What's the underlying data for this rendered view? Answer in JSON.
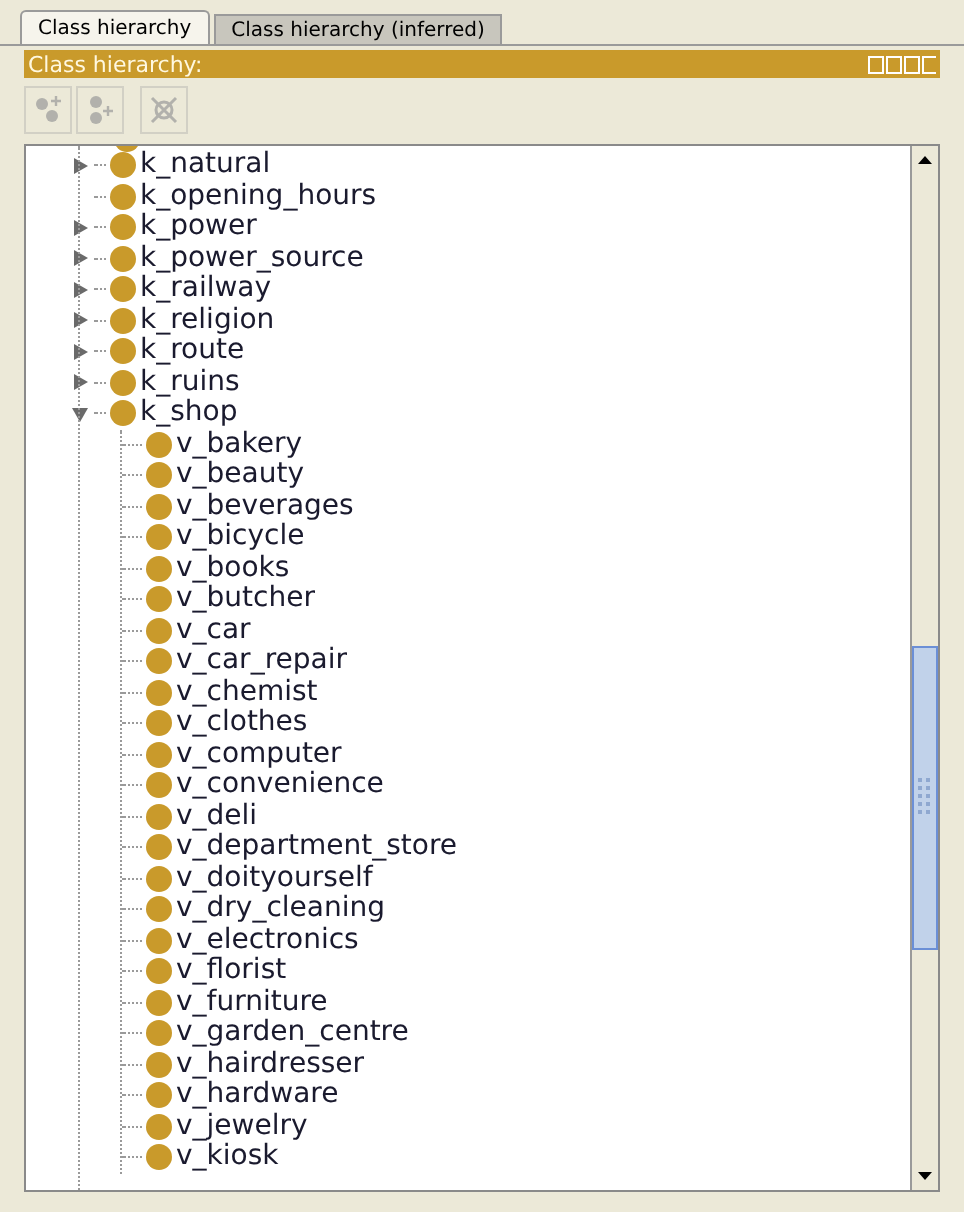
{
  "tabs": [
    {
      "label": "Class hierarchy",
      "selected": true
    },
    {
      "label": "Class hierarchy (inferred)",
      "selected": false
    }
  ],
  "panel": {
    "title": "Class hierarchy:"
  },
  "toolbar": [
    {
      "kind": "add-subclass",
      "disabled": true
    },
    {
      "kind": "add-sibling",
      "disabled": true
    },
    {
      "kind": "delete",
      "disabled": true
    }
  ],
  "tree": [
    {
      "label": "k_natural",
      "kind": "branch",
      "expanded": false
    },
    {
      "label": "k_opening_hours",
      "kind": "leaf"
    },
    {
      "label": "k_power",
      "kind": "branch",
      "expanded": false
    },
    {
      "label": "k_power_source",
      "kind": "branch",
      "expanded": false
    },
    {
      "label": "k_railway",
      "kind": "branch",
      "expanded": false
    },
    {
      "label": "k_religion",
      "kind": "branch",
      "expanded": false
    },
    {
      "label": "k_route",
      "kind": "branch",
      "expanded": false
    },
    {
      "label": "k_ruins",
      "kind": "branch",
      "expanded": false
    },
    {
      "label": "k_shop",
      "kind": "branch",
      "expanded": true,
      "children": [
        {
          "label": "v_bakery"
        },
        {
          "label": "v_beauty"
        },
        {
          "label": "v_beverages"
        },
        {
          "label": "v_bicycle"
        },
        {
          "label": "v_books"
        },
        {
          "label": "v_butcher"
        },
        {
          "label": "v_car"
        },
        {
          "label": "v_car_repair"
        },
        {
          "label": "v_chemist"
        },
        {
          "label": "v_clothes"
        },
        {
          "label": "v_computer"
        },
        {
          "label": "v_convenience"
        },
        {
          "label": "v_deli"
        },
        {
          "label": "v_department_store"
        },
        {
          "label": "v_doityourself"
        },
        {
          "label": "v_dry_cleaning"
        },
        {
          "label": "v_electronics"
        },
        {
          "label": "v_florist"
        },
        {
          "label": "v_furniture"
        },
        {
          "label": "v_garden_centre"
        },
        {
          "label": "v_hairdresser"
        },
        {
          "label": "v_hardware"
        },
        {
          "label": "v_jewelry"
        },
        {
          "label": "v_kiosk"
        }
      ]
    }
  ]
}
